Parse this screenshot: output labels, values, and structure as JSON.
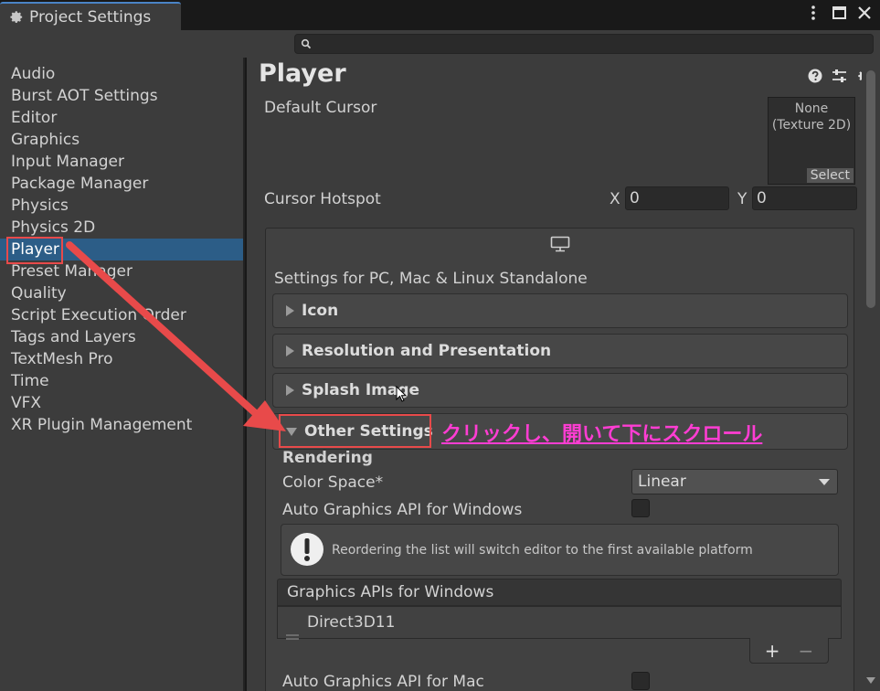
{
  "window": {
    "tab_title": "Project Settings",
    "controls": [
      "kebab-icon",
      "maximize-icon",
      "close-icon"
    ]
  },
  "search": {
    "placeholder": ""
  },
  "sidebar": {
    "items": [
      {
        "label": "Audio"
      },
      {
        "label": "Burst AOT Settings"
      },
      {
        "label": "Editor"
      },
      {
        "label": "Graphics"
      },
      {
        "label": "Input Manager"
      },
      {
        "label": "Package Manager"
      },
      {
        "label": "Physics"
      },
      {
        "label": "Physics 2D"
      },
      {
        "label": "Player",
        "active": true
      },
      {
        "label": "Preset Manager"
      },
      {
        "label": "Quality"
      },
      {
        "label": "Script Execution Order"
      },
      {
        "label": "Tags and Layers"
      },
      {
        "label": "TextMesh Pro"
      },
      {
        "label": "Time"
      },
      {
        "label": "VFX"
      },
      {
        "label": "XR Plugin Management"
      }
    ]
  },
  "main": {
    "title": "Player",
    "default_cursor": {
      "label": "Default Cursor",
      "value_line1": "None",
      "value_line2": "(Texture 2D)",
      "select_label": "Select"
    },
    "cursor_hotspot": {
      "label": "Cursor Hotspot",
      "x_label": "X",
      "x_value": "0",
      "y_label": "Y",
      "y_value": "0"
    },
    "platform_heading": "Settings for PC, Mac & Linux Standalone",
    "sections": {
      "icon": "Icon",
      "resolution": "Resolution and Presentation",
      "splash": "Splash Image",
      "other": "Other Settings"
    },
    "rendering": {
      "heading": "Rendering",
      "color_space_label": "Color Space*",
      "color_space_value": "Linear",
      "auto_api_windows_label": "Auto Graphics API  for Windows",
      "auto_api_windows_checked": false,
      "help_text": "Reordering the list will switch editor to the first available platform",
      "api_list_header": "Graphics APIs for Windows",
      "api_list_items": [
        "Direct3D11"
      ],
      "add_symbol": "+",
      "remove_symbol": "−",
      "auto_api_mac_label": "Auto Graphics API  for Mac",
      "auto_api_mac_checked": false
    }
  },
  "annotation": {
    "text": "クリックし、開いて下にスクロール",
    "color": "#ff3dd3",
    "arrow_color": "#e84a4a"
  }
}
